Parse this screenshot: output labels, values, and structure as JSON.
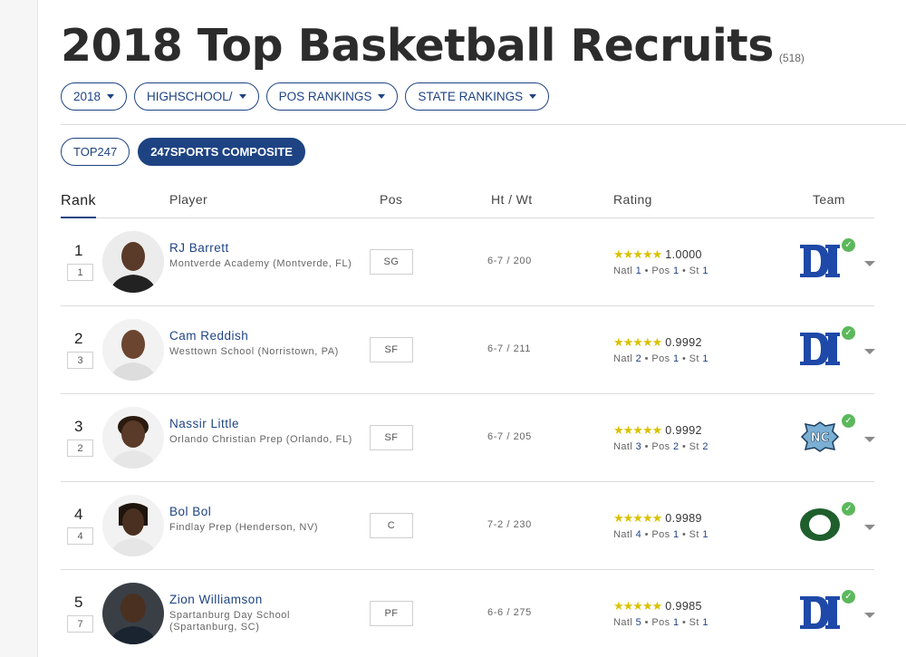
{
  "header": {
    "title": "2018 Top Basketball Recruits",
    "count": "(518)"
  },
  "filters": [
    {
      "label": "2018"
    },
    {
      "label": "HIGHSCHOOL/"
    },
    {
      "label": "POS RANKINGS"
    },
    {
      "label": "STATE RANKINGS"
    }
  ],
  "toggles": {
    "top247": "TOP247",
    "composite": "247SPORTS COMPOSITE"
  },
  "columns": {
    "rank": "Rank",
    "player": "Player",
    "pos": "Pos",
    "htwt": "Ht / Wt",
    "rating": "Rating",
    "team": "Team"
  },
  "colors": {
    "accent": "#1e4383",
    "star": "#d9c200",
    "check": "#5cb85c",
    "duke": "#1e49a8",
    "unc": "#7bafd4",
    "oregon": "#1f5f2c"
  },
  "players": [
    {
      "rank": "1",
      "sub_rank": "1",
      "name": "RJ Barrett",
      "school": "Montverde Academy (Montverde, FL)",
      "pos": "SG",
      "htwt": "6-7 / 200",
      "stars": "★★★★★",
      "score": "1.0000",
      "natl": "1",
      "pos_rank": "1",
      "st": "1",
      "team_icon": "duke-logo-icon"
    },
    {
      "rank": "2",
      "sub_rank": "3",
      "name": "Cam Reddish",
      "school": "Westtown School (Norristown, PA)",
      "pos": "SF",
      "htwt": "6-7 / 211",
      "stars": "★★★★★",
      "score": "0.9992",
      "natl": "2",
      "pos_rank": "1",
      "st": "1",
      "team_icon": "duke-logo-icon"
    },
    {
      "rank": "3",
      "sub_rank": "2",
      "name": "Nassir Little",
      "school": "Orlando Christian Prep (Orlando, FL)",
      "pos": "SF",
      "htwt": "6-7 / 205",
      "stars": "★★★★★",
      "score": "0.9992",
      "natl": "3",
      "pos_rank": "2",
      "st": "2",
      "team_icon": "unc-logo-icon"
    },
    {
      "rank": "4",
      "sub_rank": "4",
      "name": "Bol Bol",
      "school": "Findlay Prep (Henderson, NV)",
      "pos": "C",
      "htwt": "7-2 / 230",
      "stars": "★★★★★",
      "score": "0.9989",
      "natl": "4",
      "pos_rank": "1",
      "st": "1",
      "team_icon": "oregon-logo-icon"
    },
    {
      "rank": "5",
      "sub_rank": "7",
      "name": "Zion Williamson",
      "school": "Spartanburg Day School (Spartanburg, SC)",
      "pos": "PF",
      "htwt": "6-6 / 275",
      "stars": "★★★★★",
      "score": "0.9985",
      "natl": "5",
      "pos_rank": "1",
      "st": "1",
      "team_icon": "duke-logo-icon"
    }
  ],
  "labels": {
    "natl": "Natl",
    "pos": "Pos",
    "st": "St"
  }
}
